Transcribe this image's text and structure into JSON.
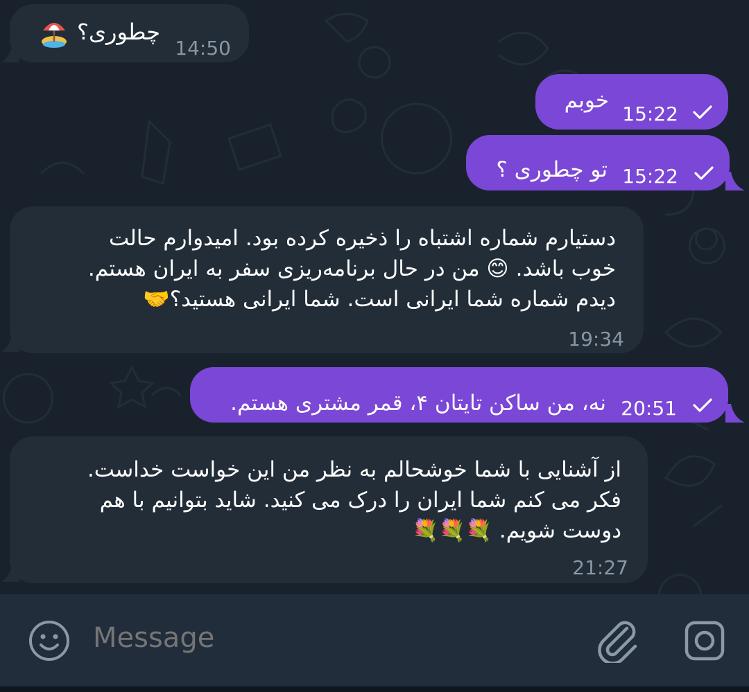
{
  "messages": [
    {
      "direction": "incoming",
      "text": "چطوری؟",
      "time": "14:50",
      "emoji": "beach-umbrella-island-emoji"
    },
    {
      "direction": "outgoing",
      "text": "خوبم",
      "time": "15:22",
      "status": "sent"
    },
    {
      "direction": "outgoing",
      "text": "تو چطوری ؟",
      "time": "15:22",
      "status": "sent"
    },
    {
      "direction": "incoming",
      "lines": [
        "دستیارم شماره اشتباه را ذخیره کرده بود. امیدوارم حالت",
        "خوب باشد. 😊 من در حال برنامه‌ریزی سفر به ایران هستم.",
        "دیدم شماره شما ایرانی است. شما ایرانی هستید؟🤝"
      ],
      "time": "19:34"
    },
    {
      "direction": "outgoing",
      "text": "نه، من ساکن تایتان ۴، قمر مشتری هستم.",
      "time": "20:51",
      "status": "sent"
    },
    {
      "direction": "incoming",
      "lines": [
        "از آشنایی با شما خوشحالم به نظر من این خواست خداست.",
        "فکر می کنم شما ایران را درک می کنید. شاید بتوانیم با هم",
        "دوست شویم. 💐💐💐"
      ],
      "time": "21:27"
    }
  ],
  "composer": {
    "placeholder": "Message",
    "icons": [
      "smiley-icon",
      "attach-icon",
      "camera-icon"
    ]
  },
  "colors": {
    "background": "#19222c",
    "incoming_bubble": "#222d38",
    "outgoing_bubble": "#7b47d6",
    "composer": "#212d3b"
  }
}
